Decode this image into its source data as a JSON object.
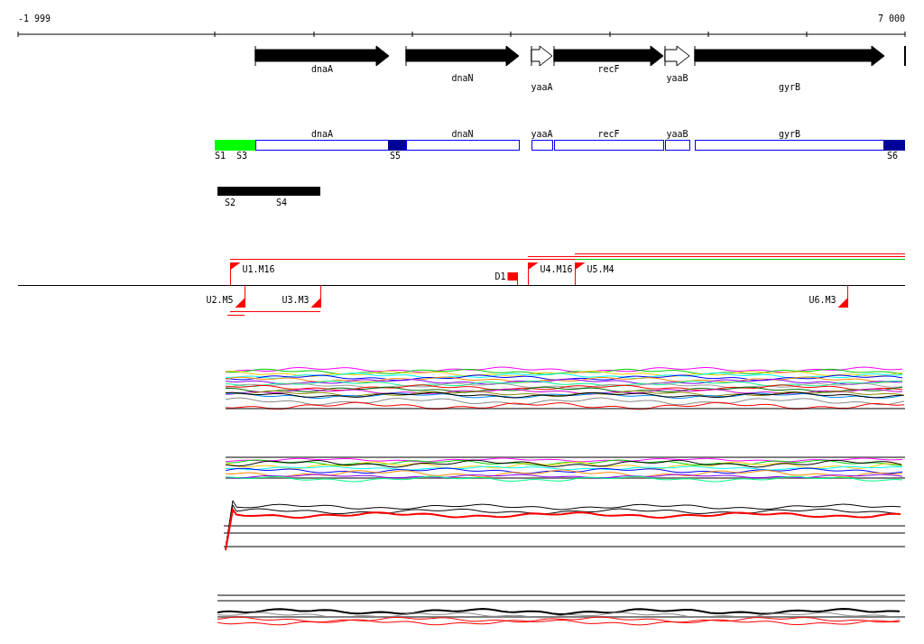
{
  "ruler": {
    "start_label": "-1 999",
    "end_label": "7 000"
  },
  "gene_arrows": [
    {
      "name": "dnaA",
      "kind": "solid"
    },
    {
      "name": "dnaN",
      "kind": "solid"
    },
    {
      "name": "yaaA",
      "kind": "outline"
    },
    {
      "name": "recF",
      "kind": "solid"
    },
    {
      "name": "yaaB",
      "kind": "outline"
    },
    {
      "name": "gyrB",
      "kind": "solid"
    },
    {
      "kind": "partial"
    }
  ],
  "gene_boxes": [
    {
      "name": "dnaA"
    },
    {
      "name": "dnaN"
    },
    {
      "name": "yaaA"
    },
    {
      "name": "recF"
    },
    {
      "name": "yaaB"
    },
    {
      "name": "gyrB"
    }
  ],
  "segment_blocks": [
    {
      "color": "#00ff00"
    },
    {
      "color": "#000099"
    },
    {
      "color": "#000099"
    }
  ],
  "segment_labels": [
    "S1",
    "S3",
    "S5",
    "S6"
  ],
  "bar_labels": [
    "S2",
    "S4"
  ],
  "features": [
    {
      "label": "U1.M16",
      "kind": "forward"
    },
    {
      "label": "U2.M5",
      "kind": "reverse"
    },
    {
      "label": "U3.M3",
      "kind": "reverse"
    },
    {
      "label": "D1",
      "kind": "block"
    },
    {
      "label": "U4.M16",
      "kind": "forward"
    },
    {
      "label": "U5.M4",
      "kind": "forward"
    },
    {
      "label": "U6.M3",
      "kind": "reverse"
    }
  ]
}
